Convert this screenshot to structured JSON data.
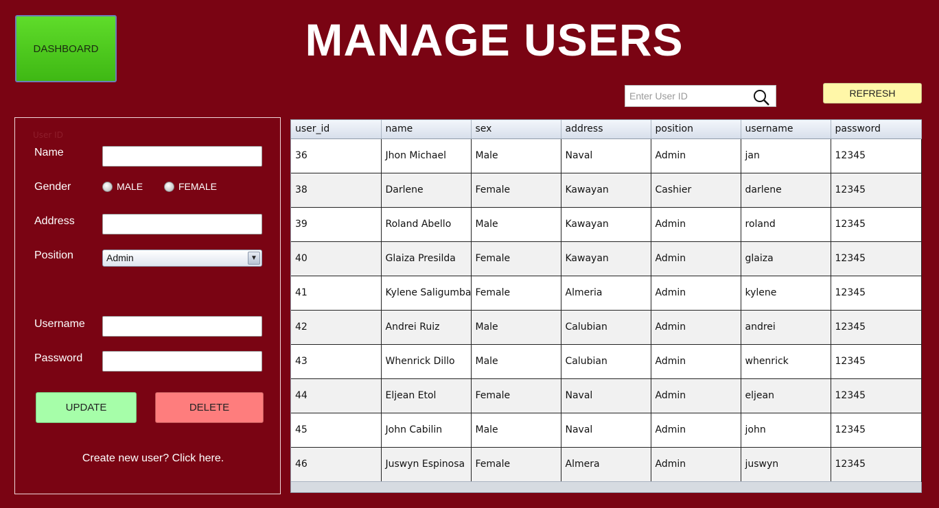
{
  "header": {
    "dashboard_label": "DASHBOARD",
    "title": "MANAGE USERS"
  },
  "search": {
    "placeholder": "Enter User ID",
    "value": ""
  },
  "refresh_label": "REFRESH",
  "form": {
    "faint_label": "User ID",
    "name_label": "Name",
    "gender_label": "Gender",
    "gender_options": [
      "MALE",
      "FEMALE"
    ],
    "address_label": "Address",
    "position_label": "Position",
    "position_value": "Admin",
    "username_label": "Username",
    "password_label": "Password",
    "update_label": "UPDATE",
    "delete_label": "DELETE",
    "create_link": "Create new user? Click here."
  },
  "table": {
    "columns": [
      "user_id",
      "name",
      "sex",
      "address",
      "position",
      "username",
      "password"
    ],
    "rows": [
      [
        "36",
        "Jhon Michael",
        "Male",
        "Naval",
        "Admin",
        "jan",
        "12345"
      ],
      [
        "38",
        "Darlene",
        "Female",
        "Kawayan",
        "Cashier",
        "darlene",
        "12345"
      ],
      [
        "39",
        "Roland Abello",
        "Male",
        "Kawayan",
        "Admin",
        "roland",
        "12345"
      ],
      [
        "40",
        "Glaiza Presilda",
        "Female",
        "Kawayan",
        "Admin",
        "glaiza",
        "12345"
      ],
      [
        "41",
        "Kylene Saligumba",
        "Female",
        "Almeria",
        "Admin",
        "kylene",
        "12345"
      ],
      [
        "42",
        "Andrei Ruiz",
        "Male",
        "Calubian",
        "Admin",
        "andrei",
        "12345"
      ],
      [
        "43",
        "Whenrick Dillo",
        "Male",
        "Calubian",
        "Admin",
        "whenrick",
        "12345"
      ],
      [
        "44",
        "Eljean Etol",
        "Female",
        "Naval",
        "Admin",
        "eljean",
        "12345"
      ],
      [
        "45",
        "John Cabilin",
        "Male",
        "Naval",
        "Admin",
        "john",
        "12345"
      ],
      [
        "46",
        "Juswyn Espinosa",
        "Female",
        "Almera",
        "Admin",
        "juswyn",
        "12345"
      ]
    ]
  },
  "colors": {
    "background": "#7a0413",
    "dashboard": "#4fcb1e",
    "refresh": "#fff7a8",
    "update": "#a6fea9",
    "delete": "#fe7d7d"
  }
}
